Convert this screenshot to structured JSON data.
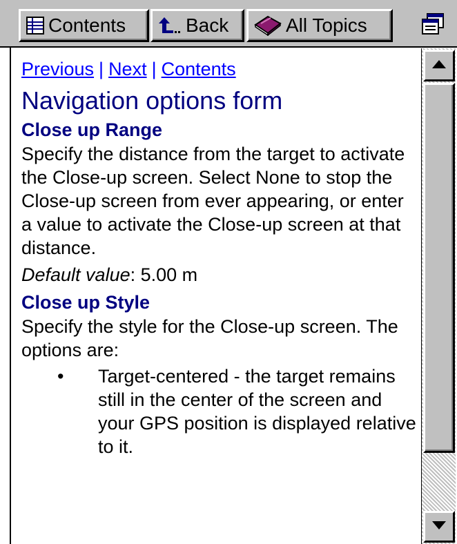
{
  "toolbar": {
    "contents_label": "Contents",
    "back_label": "Back",
    "all_topics_label": "All Topics"
  },
  "nav": {
    "previous": "Previous",
    "next": "Next",
    "contents": "Contents",
    "separator": "|"
  },
  "page": {
    "title": "Navigation options form",
    "sections": [
      {
        "heading": "Close up Range",
        "body": "Specify the distance from the target to activate the Close-up screen. Select None to stop the Close-up screen from ever appearing, or enter a value to activate the Close-up screen at that distance.",
        "default_label": "Default value",
        "default_value": ": 5.00 m"
      },
      {
        "heading": "Close up Style",
        "body": "Specify the style for the Close-up screen. The options are:",
        "bullets": [
          "Target-centered - the target remains still in the center of the screen and your GPS position is displayed relative to it."
        ]
      }
    ]
  },
  "colors": {
    "link": "#0000ff",
    "heading": "#000080",
    "chrome": "#c0c0c0"
  },
  "icons": {
    "contents": "contents-grid-icon",
    "back": "back-arrow-icon",
    "all_topics": "book-icon",
    "window": "window-menu-icon",
    "scroll_up": "scroll-up-arrow-icon",
    "scroll_down": "scroll-down-arrow-icon"
  }
}
